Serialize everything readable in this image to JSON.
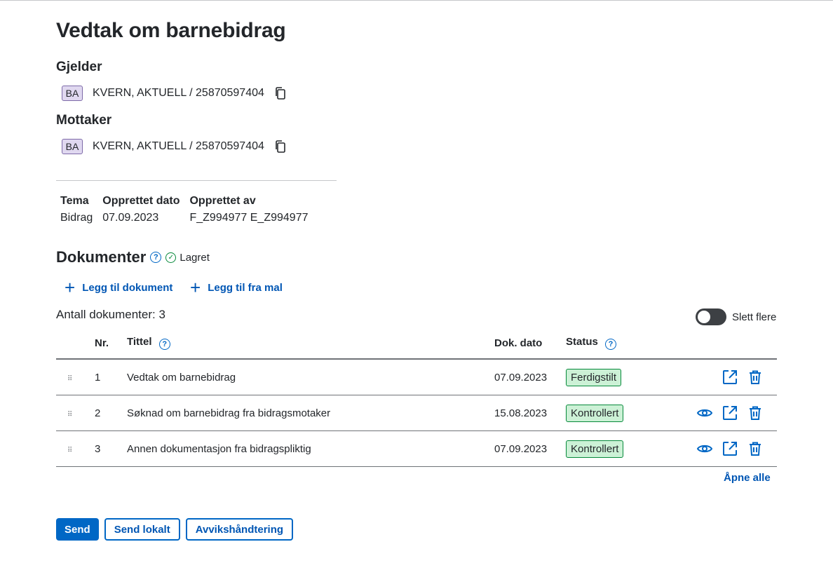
{
  "page": {
    "title": "Vedtak om barnebidrag"
  },
  "gjelder": {
    "label": "Gjelder",
    "badge": "BA",
    "person": "KVERN, AKTUELL / 25870597404"
  },
  "mottaker": {
    "label": "Mottaker",
    "badge": "BA",
    "person": "KVERN, AKTUELL / 25870597404"
  },
  "meta": {
    "headers": [
      "Tema",
      "Opprettet dato",
      "Opprettet av"
    ],
    "values": [
      "Bidrag",
      "07.09.2023",
      "F_Z994977 E_Z994977"
    ]
  },
  "documents": {
    "title": "Dokumenter",
    "saved_label": "Lagret",
    "add_document": "Legg til dokument",
    "add_from_template": "Legg til fra mal",
    "count_label": "Antall dokumenter: 3",
    "toggle_label": "Slett flere",
    "columns": {
      "nr": "Nr.",
      "title": "Tittel",
      "date": "Dok. dato",
      "status": "Status"
    },
    "rows": [
      {
        "nr": "1",
        "title": "Vedtak om barnebidrag",
        "date": "07.09.2023",
        "status": "Ferdigstilt"
      },
      {
        "nr": "2",
        "title": "Søknad om barnebidrag fra bidragsmotaker",
        "date": "15.08.2023",
        "status": "Kontrollert"
      },
      {
        "nr": "3",
        "title": "Annen dokumentasjon fra bidragspliktig",
        "date": "07.09.2023",
        "status": "Kontrollert"
      }
    ],
    "open_all": "Åpne alle"
  },
  "actions": {
    "send": "Send",
    "send_local": "Send lokalt",
    "deviation": "Avvikshåndtering"
  },
  "colors": {
    "accent": "#0067c5",
    "success_bg": "#ccf1d6",
    "badge_bg": "#e0d8f0"
  }
}
